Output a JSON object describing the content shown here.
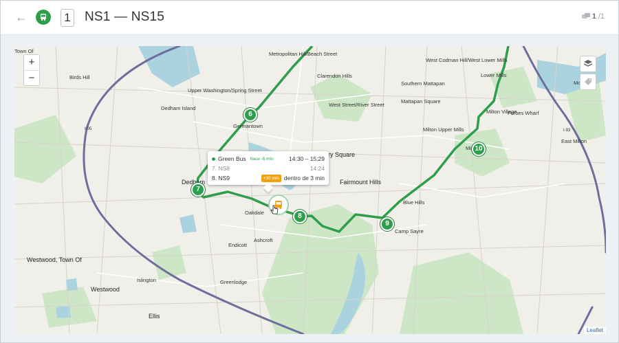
{
  "header": {
    "route_number": "1",
    "route_title": "NS1 — NS15",
    "vehicle_count": "1",
    "vehicle_total": "/1"
  },
  "map": {
    "labels": {
      "town_of": "Town Of",
      "birds_hill": "Birds Hill",
      "metropolitan_hill": "Metropolitan Hill/Beach Street",
      "clarendon_hills": "Clarendon Hills",
      "west_codman": "West Codman Hill/West Lower Mills",
      "lower_mills": "Lower Mills",
      "southern_mattapan": "Southern Mattapan",
      "upper_washington": "Upper Washington/Spring Street",
      "west_street": "West Street/River Street",
      "mattapan_square": "Mattapan Square",
      "dedham_island": "Dedham Island",
      "germantown": "Germantown",
      "milton_upper_mills": "Milton Upper Mills",
      "milton_village": "Milton Village",
      "forbes_wharf": "Forbes Wharf",
      "east_milton": "East Milton",
      "dedham": "Dedham",
      "fairmount_hills": "Fairmount Hills",
      "ry_square": "ry Square",
      "oakdale": "Oakdale",
      "ashcroft": "Ashcroft",
      "endicott": "Endicott",
      "camp_sayre": "Camp Sayre",
      "blue_hills": "Blue Hills",
      "westwood_town": "Westwood, Town Of",
      "islington": "Islington",
      "westwood": "Westwood",
      "greenlodge": "Greenlodge",
      "ellis": "Ellis",
      "mi": "Mi",
      "montclair": "Montclair",
      "i93": "I-93",
      "i95": "I-95"
    },
    "stops": [
      "6",
      "7",
      "8",
      "9",
      "10"
    ],
    "zoom_in": "+",
    "zoom_out": "−",
    "attribution": "Leaflet"
  },
  "popup": {
    "vehicle_name": "Green Bus",
    "vehicle_status": "hace -6 min",
    "vehicle_window": "14:30 – 15:29",
    "prev_stop": "7. NS8",
    "prev_time": "14:24",
    "next_stop": "8. NS9",
    "next_delay": "+30 min",
    "next_eta": "dentro de 3 min"
  },
  "colors": {
    "route": "#2e9e4d",
    "highway": "#6d6f9a",
    "water": "#aad3df",
    "park": "#cde6c6"
  }
}
